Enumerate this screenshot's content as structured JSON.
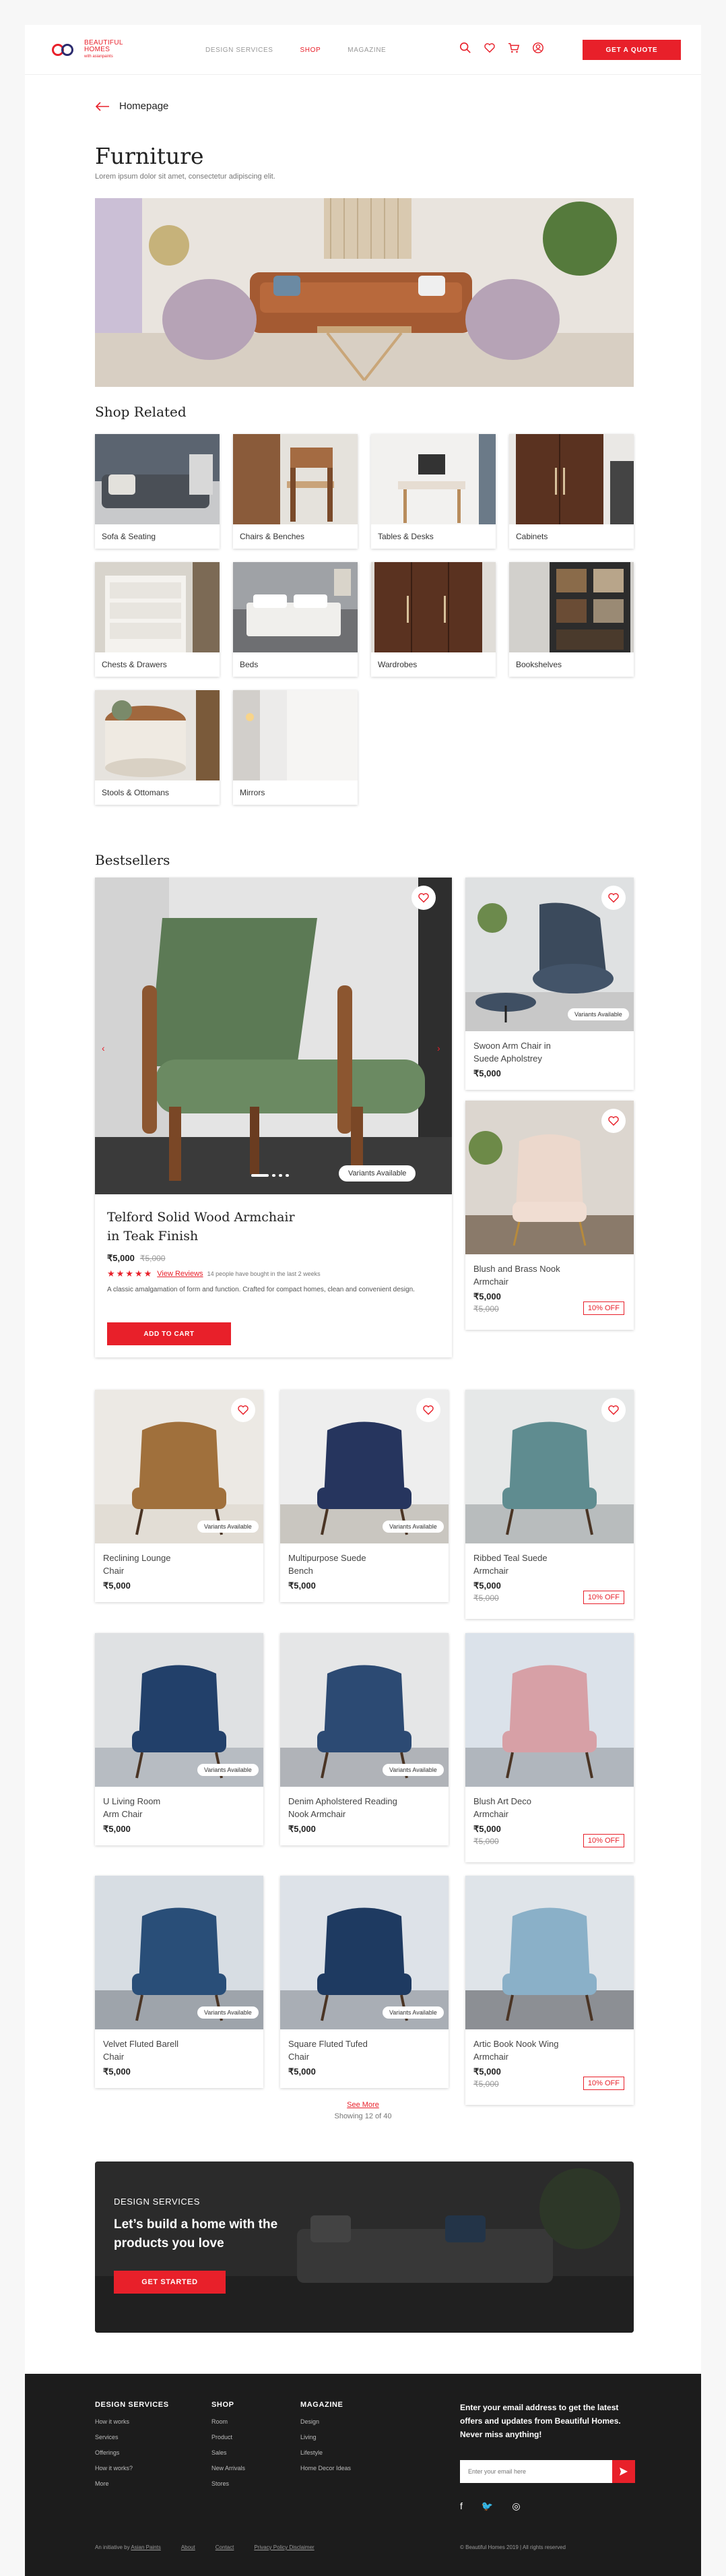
{
  "header": {
    "logo": {
      "line1": "BEAUTIFUL",
      "line2": "HOMES",
      "line3": "with asianpaints"
    },
    "nav": [
      "DESIGN SERVICES",
      "SHOP",
      "MAGAZINE"
    ],
    "icons": [
      "search-icon",
      "heart-icon",
      "cart-icon",
      "user-icon"
    ],
    "cta": "GET A QUOTE"
  },
  "breadcrumb": {
    "label": "Homepage"
  },
  "page": {
    "title": "Furniture",
    "subtitle": "Lorem ipsum dolor sit amet, consectetur adipiscing elit."
  },
  "shop_related": {
    "title": "Shop Related",
    "items": [
      {
        "label": "Sofa & Seating"
      },
      {
        "label": "Chairs & Benches"
      },
      {
        "label": "Tables & Desks"
      },
      {
        "label": "Cabinets"
      },
      {
        "label": "Chests & Drawers"
      },
      {
        "label": "Beds"
      },
      {
        "label": "Wardrobes"
      },
      {
        "label": "Bookshelves"
      },
      {
        "label": "Stools & Ottomans"
      },
      {
        "label": "Mirrors"
      }
    ]
  },
  "bestsellers": {
    "title": "Bestsellers",
    "featured": {
      "name_line1": "Telford Solid Wood Armchair",
      "name_line2": "in Teak Finish",
      "price": "₹5,000",
      "old_price": "₹5,000",
      "rating": 5,
      "reviews_link": "View Reviews",
      "bought": "14 people have bought in the last 2 weeks",
      "description": "A classic amalgamation of form and function. Crafted for compact homes, clean and convenient design.",
      "variants": "Variants Available",
      "add_to_cart": "ADD TO CART",
      "slides": 4,
      "active_slide": 0
    },
    "side": [
      {
        "name_line1": "Swoon Arm Chair in",
        "name_line2": "Suede Apholstrey",
        "price": "₹5,000",
        "variants": "Variants Available"
      },
      {
        "name_line1": "Blush and Brass Nook",
        "name_line2": "Armchair",
        "price": "₹5,000",
        "old_price": "₹5,000",
        "off": "10% OFF"
      }
    ]
  },
  "products": [
    {
      "name_line1": "Reclining Lounge",
      "name_line2": "Chair",
      "price": "₹5,000",
      "variants": "Variants Available"
    },
    {
      "name_line1": "Multipurpose Suede",
      "name_line2": "Bench",
      "price": "₹5,000",
      "variants": "Variants Available"
    },
    {
      "name_line1": "Ribbed Teal Suede",
      "name_line2": "Armchair",
      "price": "₹5,000",
      "old_price": "₹5,000",
      "off": "10% OFF"
    },
    {
      "name_line1": "U Living Room",
      "name_line2": "Arm Chair",
      "price": "₹5,000",
      "variants": "Variants Available"
    },
    {
      "name_line1": "Denim Apholstered Reading",
      "name_line2": "Nook Armchair",
      "price": "₹5,000",
      "variants": "Variants Available"
    },
    {
      "name_line1": "Blush Art Deco",
      "name_line2": "Armchair",
      "price": "₹5,000",
      "old_price": "₹5,000",
      "off": "10% OFF"
    },
    {
      "name_line1": "Velvet Fluted Barell",
      "name_line2": "Chair",
      "price": "₹5,000",
      "variants": "Variants Available"
    },
    {
      "name_line1": "Square Fluted Tufed",
      "name_line2": "Chair",
      "price": "₹5,000",
      "variants": "Variants Available"
    },
    {
      "name_line1": "Artic Book Nook Wing",
      "name_line2": "Armchair",
      "price": "₹5,000",
      "old_price": "₹5,000",
      "off": "10% OFF"
    }
  ],
  "pagination": {
    "see_more": "See More",
    "showing": "Showing 12 of 40"
  },
  "banner": {
    "tag": "DESIGN SERVICES",
    "headline": "Let’s build a home with the products you love",
    "cta": "GET STARTED"
  },
  "footer": {
    "columns": [
      {
        "title": "DESIGN SERVICES",
        "items": [
          "How it works",
          "Services",
          "Offerings",
          "How it works?",
          "More"
        ]
      },
      {
        "title": "SHOP",
        "items": [
          "Room",
          "Product",
          "Sales",
          "New Arrivals",
          "Stores"
        ]
      },
      {
        "title": "MAGAZINE",
        "items": [
          "Design",
          "Living",
          "Lifestyle",
          "Home Decor Ideas"
        ]
      }
    ],
    "newsletter": "Enter your email address to get the latest offers and updates from Beautiful Homes. Never miss anything!",
    "email_placeholder": "Enter your email here",
    "social": [
      "facebook-icon",
      "twitter-icon",
      "instagram-icon"
    ],
    "bottom_prefix": "An initiative by",
    "bottom_links": [
      "Asian Paints",
      "About",
      "Contact",
      "Privacy Policy Disclaimer"
    ],
    "copyright": "© Beautiful Homes 2019 | All rights reserved"
  },
  "colors": {
    "accent": "#e8202a",
    "footer_bg": "#1c1c1c"
  }
}
